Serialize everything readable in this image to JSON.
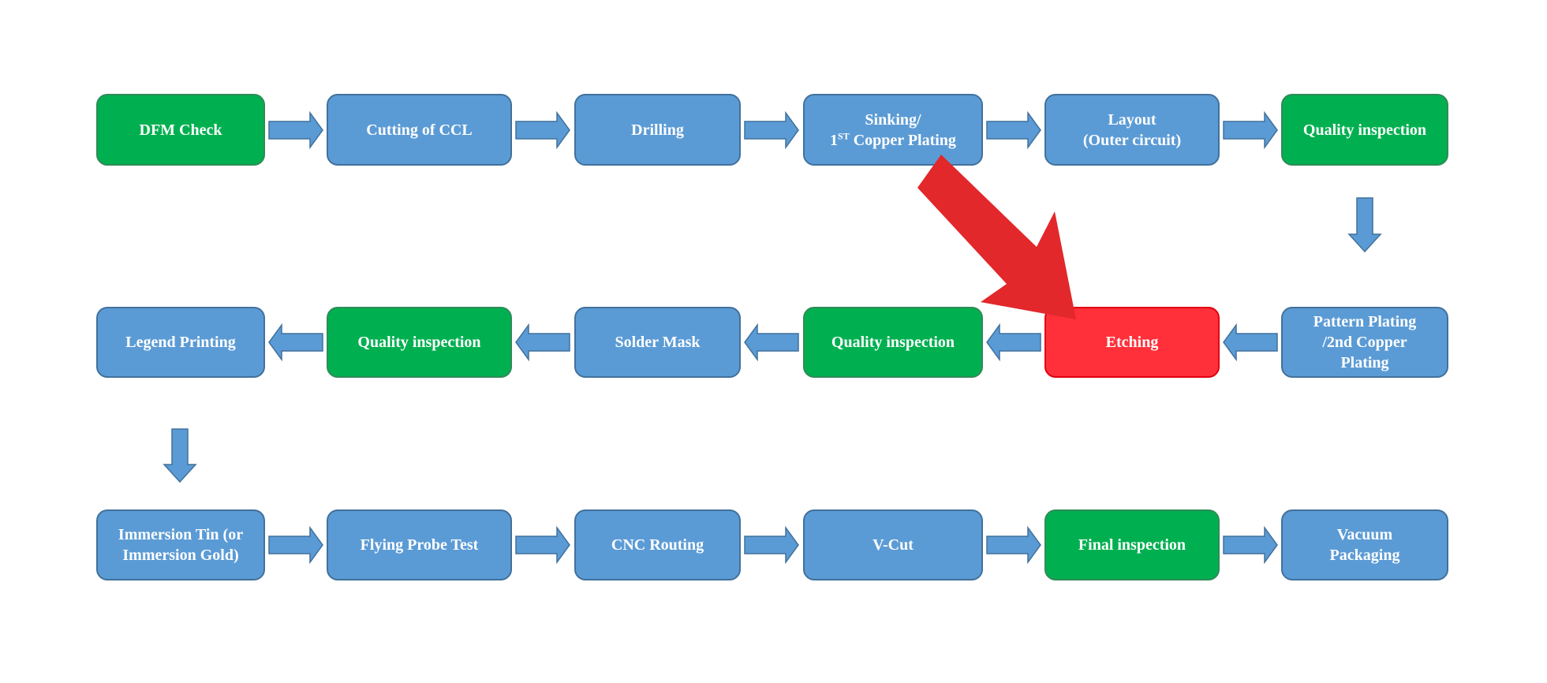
{
  "colors": {
    "process": "#5B9BD5",
    "inspection": "#00B050",
    "highlight": "#FF303A",
    "pointer": "#E2282B",
    "connector": "#5B9BD5"
  },
  "rows": [
    {
      "direction": "right",
      "steps": [
        {
          "label": "DFM Check",
          "type": "inspection"
        },
        {
          "label": "Cutting of CCL",
          "type": "process"
        },
        {
          "label": "Drilling",
          "type": "process"
        },
        {
          "label": "Sinking/",
          "label2_pre": "1",
          "label2_sup": "ST",
          "label2_post": " Copper Plating",
          "type": "process"
        },
        {
          "label": "Layout",
          "label2": "(Outer circuit)",
          "type": "process"
        },
        {
          "label": "Quality inspection",
          "type": "inspection"
        }
      ]
    },
    {
      "direction": "left",
      "steps": [
        {
          "label": "Legend Printing",
          "type": "process"
        },
        {
          "label": "Quality inspection",
          "type": "inspection"
        },
        {
          "label": "Solder Mask",
          "type": "process"
        },
        {
          "label": "Quality inspection",
          "type": "inspection"
        },
        {
          "label": "Etching",
          "type": "highlight"
        },
        {
          "label": "Pattern Plating",
          "label2": "/2nd Copper",
          "label3": "Plating",
          "type": "process"
        }
      ]
    },
    {
      "direction": "right",
      "steps": [
        {
          "label": "Immersion Tin (or",
          "label2": "Immersion Gold)",
          "type": "process"
        },
        {
          "label": "Flying Probe Test",
          "type": "process"
        },
        {
          "label": "CNC Routing",
          "type": "process"
        },
        {
          "label": "V-Cut",
          "type": "process"
        },
        {
          "label": "Final inspection",
          "type": "inspection"
        },
        {
          "label": "Vacuum",
          "label2": "Packaging",
          "type": "process"
        }
      ]
    }
  ],
  "pointer": {
    "target": "Etching",
    "icon": "red-arrow-icon"
  }
}
